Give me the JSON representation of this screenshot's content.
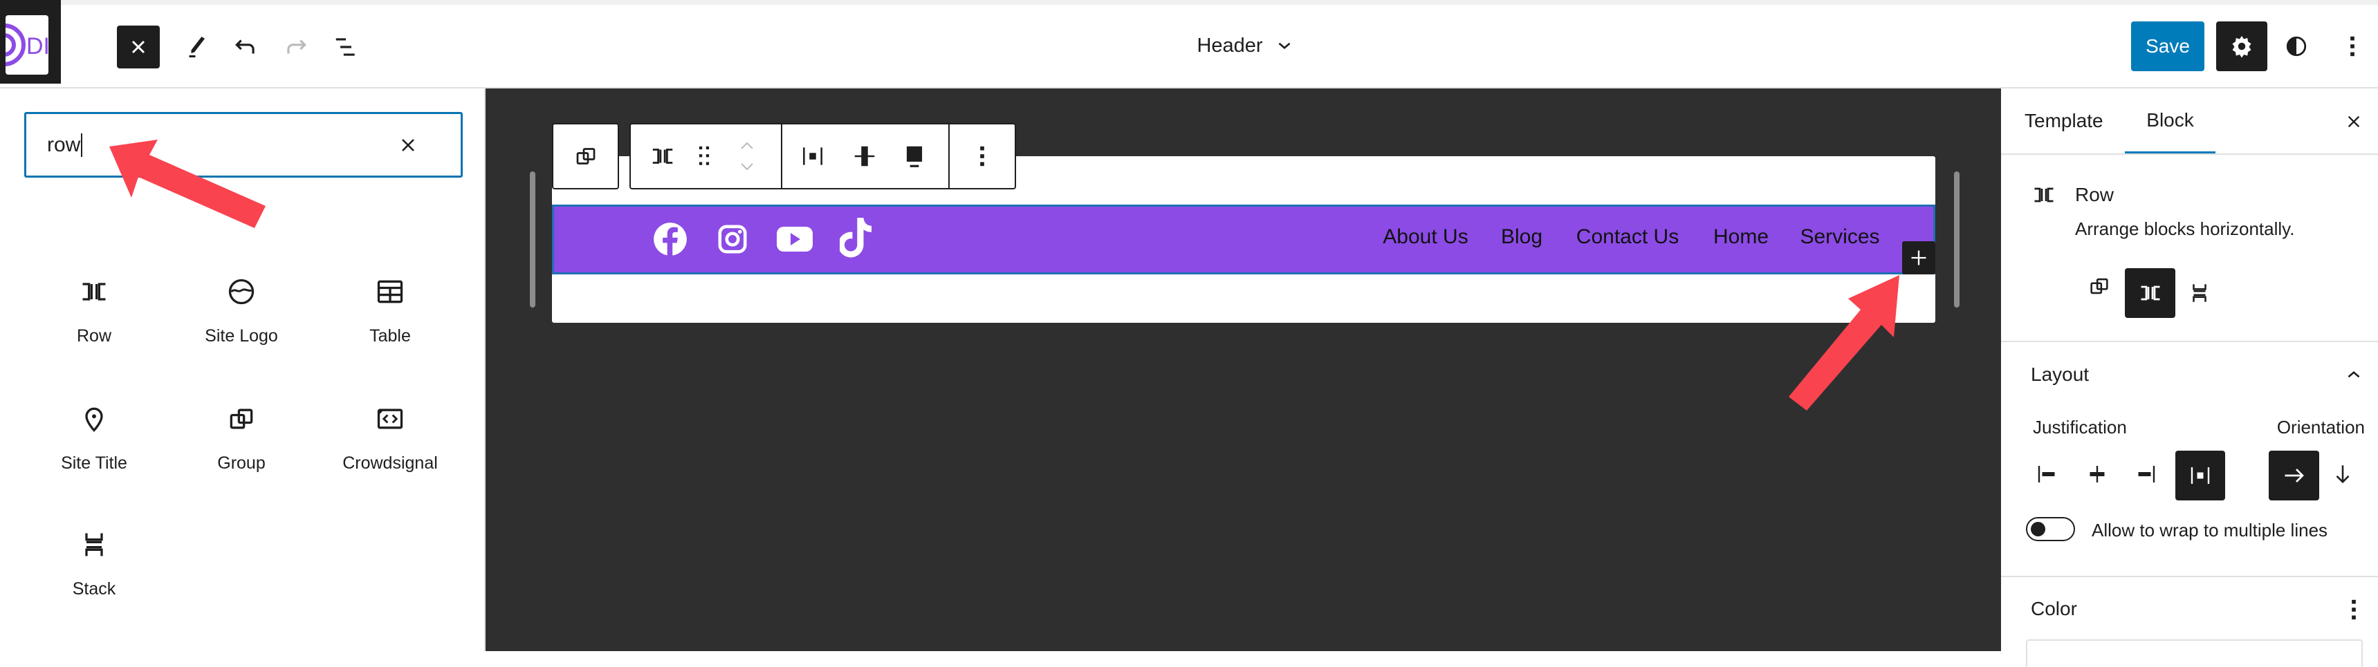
{
  "header": {
    "logo_text": "DI",
    "document_title": "Header",
    "save_label": "Save"
  },
  "inserter": {
    "search_value": "row",
    "blocks": [
      {
        "label": "Row",
        "icon": "row-icon"
      },
      {
        "label": "Site Logo",
        "icon": "site-logo-icon"
      },
      {
        "label": "Table",
        "icon": "table-icon"
      },
      {
        "label": "Site Title",
        "icon": "map-marker-icon"
      },
      {
        "label": "Group",
        "icon": "group-icon"
      },
      {
        "label": "Crowdsignal",
        "icon": "embed-code-icon"
      },
      {
        "label": "Stack",
        "icon": "stack-icon"
      }
    ]
  },
  "canvas": {
    "row_color": "#8c4be5",
    "social_icons": [
      "facebook-icon",
      "instagram-icon",
      "youtube-icon",
      "tiktok-icon"
    ],
    "nav_items": [
      "About Us",
      "Blog",
      "Contact Us",
      "Home",
      "Services"
    ]
  },
  "sidebar": {
    "tabs": [
      "Template",
      "Block"
    ],
    "active_tab": "Block",
    "block_name": "Row",
    "block_description": "Arrange blocks horizontally.",
    "layout": {
      "title": "Layout",
      "justification_label": "Justification",
      "justification_selected": "space-between",
      "orientation_label": "Orientation",
      "orientation_selected": "horizontal",
      "wrap_label": "Allow to wrap to multiple lines",
      "wrap_enabled": false
    },
    "color_title": "Color"
  },
  "colors": {
    "accent": "#007cba",
    "annotation_arrow": "#f9434f"
  }
}
